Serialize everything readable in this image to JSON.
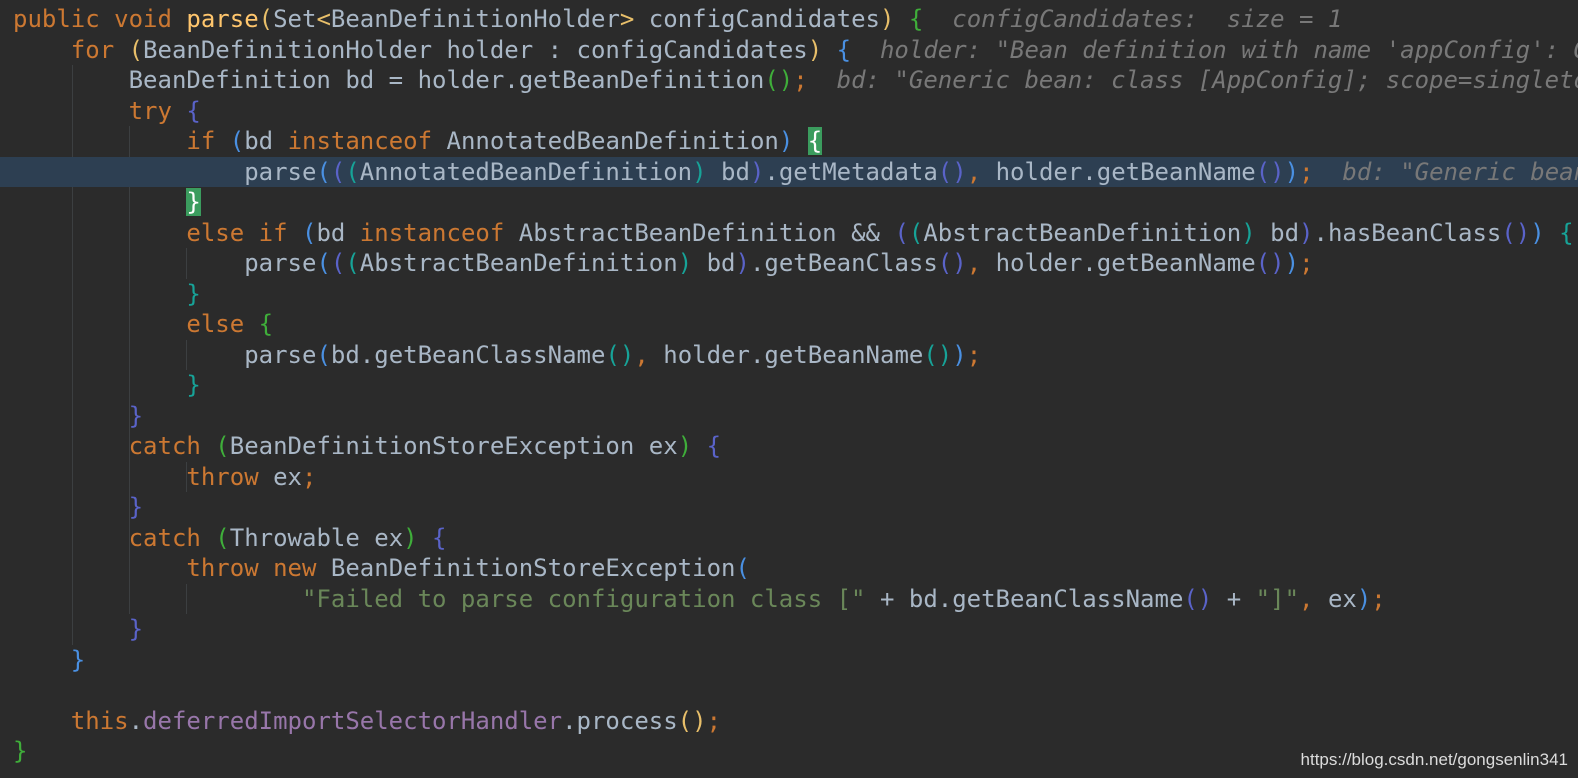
{
  "code": {
    "current_line": 5,
    "lines": [
      [
        [
          "public void ",
          "t-kw"
        ],
        [
          "parse",
          "t-fn"
        ],
        [
          "(",
          "b1"
        ],
        [
          "Set",
          "t-plain"
        ],
        [
          "<",
          "b1"
        ],
        [
          "BeanDefinitionHolder",
          "t-plain"
        ],
        [
          ">",
          "b1"
        ],
        [
          " configCandidates",
          "t-plain"
        ],
        [
          ")",
          "b1"
        ],
        [
          " ",
          "t-plain"
        ],
        [
          "{",
          "b2"
        ],
        [
          "  configCandidates:  size = 1",
          "t-hint"
        ]
      ],
      [
        [
          "    ",
          "t-plain"
        ],
        [
          "for ",
          "t-kw"
        ],
        [
          "(",
          "b1"
        ],
        [
          "BeanDefinitionHolder holder : configCandidates",
          "t-plain"
        ],
        [
          ")",
          "b1"
        ],
        [
          " ",
          "t-plain"
        ],
        [
          "{",
          "b3"
        ],
        [
          "  holder: \"Bean definition with name 'appConfig': Generic bean: class [AppConfig]\"",
          "t-hint"
        ]
      ],
      [
        [
          "        BeanDefinition bd = holder.getBeanDefinition",
          "t-plain"
        ],
        [
          "()",
          "b2"
        ],
        [
          ";",
          "t-kw"
        ],
        [
          "  bd: \"Generic bean: class [AppConfig]; scope=singleton; abstract=false\"",
          "t-hint"
        ]
      ],
      [
        [
          "        ",
          "t-plain"
        ],
        [
          "try ",
          "t-kw"
        ],
        [
          "{",
          "b4"
        ]
      ],
      [
        [
          "            ",
          "t-plain"
        ],
        [
          "if ",
          "t-kw"
        ],
        [
          "(",
          "b3"
        ],
        [
          "bd ",
          "t-plain"
        ],
        [
          "instanceof ",
          "t-kw"
        ],
        [
          "AnnotatedBeanDefinition",
          "t-plain"
        ],
        [
          ")",
          "b3"
        ],
        [
          " ",
          "t-plain"
        ],
        [
          "{",
          "bm"
        ]
      ],
      [
        [
          "                parse",
          "t-plain"
        ],
        [
          "(",
          "b3"
        ],
        [
          "(",
          "b4"
        ],
        [
          "(",
          "b5"
        ],
        [
          "AnnotatedBeanDefinition",
          "t-plain"
        ],
        [
          ")",
          "b5"
        ],
        [
          " bd",
          "t-plain"
        ],
        [
          ")",
          "b4"
        ],
        [
          ".getMetadata",
          "t-plain"
        ],
        [
          "()",
          "b4"
        ],
        [
          ", ",
          "t-kw"
        ],
        [
          "holder.getBeanName",
          "t-plain"
        ],
        [
          "()",
          "b4"
        ],
        [
          ")",
          "b3"
        ],
        [
          ";",
          "t-kw"
        ],
        [
          "  bd: \"Generic bean: class [AppConfig]; scope=singleton\"",
          "t-hint"
        ]
      ],
      [
        [
          "            ",
          "t-plain"
        ],
        [
          "}",
          "bm"
        ]
      ],
      [
        [
          "            ",
          "t-plain"
        ],
        [
          "else if ",
          "t-kw"
        ],
        [
          "(",
          "b3"
        ],
        [
          "bd ",
          "t-plain"
        ],
        [
          "instanceof ",
          "t-kw"
        ],
        [
          "AbstractBeanDefinition && ",
          "t-plain"
        ],
        [
          "(",
          "b4"
        ],
        [
          "(",
          "b5"
        ],
        [
          "AbstractBeanDefinition",
          "t-plain"
        ],
        [
          ")",
          "b5"
        ],
        [
          " bd",
          "t-plain"
        ],
        [
          ")",
          "b4"
        ],
        [
          ".hasBeanClass",
          "t-plain"
        ],
        [
          "()",
          "b4"
        ],
        [
          ")",
          "b3"
        ],
        [
          " ",
          "t-plain"
        ],
        [
          "{",
          "b5"
        ]
      ],
      [
        [
          "                parse",
          "t-plain"
        ],
        [
          "(",
          "b3"
        ],
        [
          "(",
          "b4"
        ],
        [
          "(",
          "b5"
        ],
        [
          "AbstractBeanDefinition",
          "t-plain"
        ],
        [
          ")",
          "b5"
        ],
        [
          " bd",
          "t-plain"
        ],
        [
          ")",
          "b4"
        ],
        [
          ".getBeanClass",
          "t-plain"
        ],
        [
          "()",
          "b4"
        ],
        [
          ", ",
          "t-kw"
        ],
        [
          "holder.getBeanName",
          "t-plain"
        ],
        [
          "()",
          "b4"
        ],
        [
          ")",
          "b3"
        ],
        [
          ";",
          "t-kw"
        ]
      ],
      [
        [
          "            ",
          "t-plain"
        ],
        [
          "}",
          "b5"
        ]
      ],
      [
        [
          "            ",
          "t-plain"
        ],
        [
          "else ",
          "t-kw"
        ],
        [
          "{",
          "b2"
        ]
      ],
      [
        [
          "                parse",
          "t-plain"
        ],
        [
          "(",
          "b3"
        ],
        [
          "bd.getBeanClassName",
          "t-plain"
        ],
        [
          "()",
          "b5"
        ],
        [
          ", ",
          "t-kw"
        ],
        [
          "holder.getBeanName",
          "t-plain"
        ],
        [
          "()",
          "b5"
        ],
        [
          ")",
          "b3"
        ],
        [
          ";",
          "t-kw"
        ]
      ],
      [
        [
          "            ",
          "t-plain"
        ],
        [
          "}",
          "b5"
        ]
      ],
      [
        [
          "        ",
          "t-plain"
        ],
        [
          "}",
          "b4"
        ]
      ],
      [
        [
          "        ",
          "t-plain"
        ],
        [
          "catch ",
          "t-kw"
        ],
        [
          "(",
          "b2"
        ],
        [
          "BeanDefinitionStoreException ex",
          "t-plain"
        ],
        [
          ")",
          "b2"
        ],
        [
          " ",
          "t-plain"
        ],
        [
          "{",
          "b4"
        ]
      ],
      [
        [
          "            ",
          "t-plain"
        ],
        [
          "throw ",
          "t-kw"
        ],
        [
          "ex",
          "t-plain"
        ],
        [
          ";",
          "t-kw"
        ]
      ],
      [
        [
          "        ",
          "t-plain"
        ],
        [
          "}",
          "b4"
        ]
      ],
      [
        [
          "        ",
          "t-plain"
        ],
        [
          "catch ",
          "t-kw"
        ],
        [
          "(",
          "b2"
        ],
        [
          "Throwable ex",
          "t-plain"
        ],
        [
          ")",
          "b2"
        ],
        [
          " ",
          "t-plain"
        ],
        [
          "{",
          "b4"
        ]
      ],
      [
        [
          "            ",
          "t-plain"
        ],
        [
          "throw new ",
          "t-kw"
        ],
        [
          "BeanDefinitionStoreException",
          "t-plain"
        ],
        [
          "(",
          "b3"
        ]
      ],
      [
        [
          "                    ",
          "t-plain"
        ],
        [
          "\"Failed to parse configuration class [\"",
          "t-str"
        ],
        [
          " + bd.getBeanClassName",
          "t-plain"
        ],
        [
          "()",
          "b4"
        ],
        [
          " + ",
          "t-plain"
        ],
        [
          "\"]\"",
          "t-str"
        ],
        [
          ", ",
          "t-kw"
        ],
        [
          "ex",
          "t-plain"
        ],
        [
          ")",
          "b3"
        ],
        [
          ";",
          "t-kw"
        ]
      ],
      [
        [
          "        ",
          "t-plain"
        ],
        [
          "}",
          "b4"
        ]
      ],
      [
        [
          "    ",
          "t-plain"
        ],
        [
          "}",
          "b3"
        ]
      ],
      [],
      [
        [
          "    ",
          "t-plain"
        ],
        [
          "this",
          "t-kw"
        ],
        [
          ".",
          "t-plain"
        ],
        [
          "deferredImportSelectorHandler",
          "t-field"
        ],
        [
          ".process",
          "t-plain"
        ],
        [
          "()",
          "b1"
        ],
        [
          ";",
          "t-kw"
        ]
      ],
      [
        [
          "}",
          "b2"
        ]
      ]
    ]
  },
  "watermark": "https://blog.csdn.net/gongsenlin341"
}
